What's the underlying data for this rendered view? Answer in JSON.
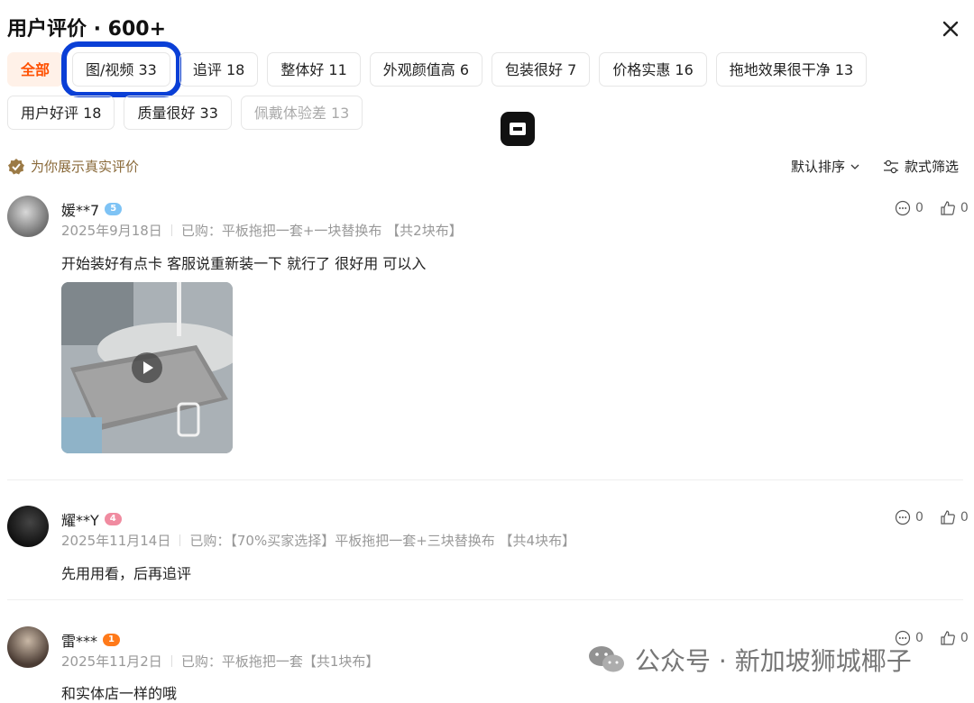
{
  "header": {
    "title": "用户评价 · 600+"
  },
  "tags": [
    {
      "label": "全部",
      "active": true
    },
    {
      "label": "图/视频 33",
      "highlight": true
    },
    {
      "label": "追评 18"
    },
    {
      "label": "整体好 11"
    },
    {
      "label": "外观颜值高 6"
    },
    {
      "label": "包装很好 7"
    },
    {
      "label": "价格实惠 16"
    },
    {
      "label": "拖地效果很干净 13"
    },
    {
      "label": "用户好评 18"
    },
    {
      "label": "质量很好 33"
    },
    {
      "label": "佩戴体验差 13",
      "muted": true
    }
  ],
  "verified_label": "为你展示真实评价",
  "sort": {
    "default_label": "默认排序",
    "filter_label": "款式筛选"
  },
  "reviews": [
    {
      "user": "媛**7",
      "level": "5",
      "level_color": "#7ec3f5",
      "date": "2025年9月18日",
      "purchase": "已购：平板拖把一套+一块替换布 【共2块布】",
      "text": "开始装好有点卡 客服说重新装一下 就行了 很好用 可以入",
      "comments": "0",
      "likes": "0"
    },
    {
      "user": "耀**Y",
      "level": "4",
      "level_color": "#f08ba0",
      "date": "2025年11月14日",
      "purchase": "已购：【70%买家选择】平板拖把一套+三块替换布 【共4块布】",
      "text": "先用用看，后再追评",
      "comments": "0",
      "likes": "0"
    },
    {
      "user": "雷***",
      "level": "1",
      "level_color": "#ff7a1a",
      "date": "2025年11月2日",
      "purchase": "已购：平板拖把一套【共1块布】",
      "text": "和实体店一样的哦",
      "comments": "0",
      "likes": "0"
    }
  ],
  "watermark": "公众号 · 新加坡狮城椰子"
}
